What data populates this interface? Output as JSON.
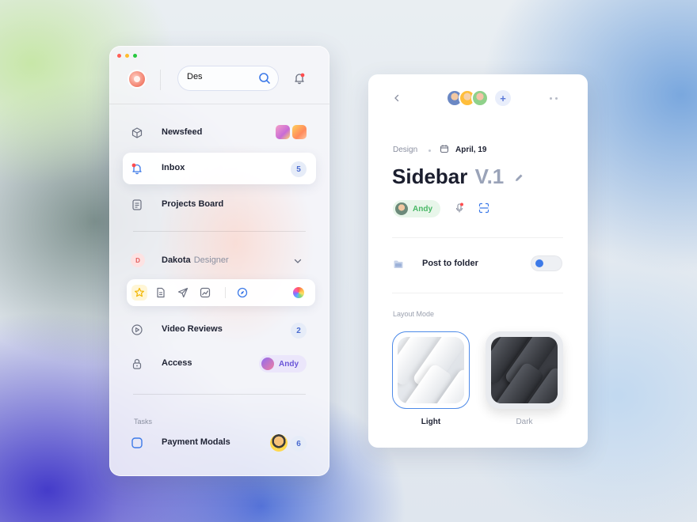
{
  "sidebar": {
    "search": {
      "value": "Des"
    },
    "nav": [
      {
        "label": "Newsfeed"
      },
      {
        "label": "Inbox",
        "badge": "5"
      },
      {
        "label": "Projects Board"
      }
    ],
    "user": {
      "initial": "D",
      "name": "Dakota",
      "role": "Designer"
    },
    "secondary": [
      {
        "label": "Video Reviews",
        "badge": "2"
      },
      {
        "label": "Access",
        "assignee": "Andy"
      }
    ],
    "tasks_label": "Tasks",
    "tasks": [
      {
        "label": "Payment Modals",
        "badge": "6"
      }
    ]
  },
  "detail": {
    "add_label": "+",
    "category": "Design",
    "date": "April, 19",
    "title": "Sidebar",
    "version": "V.1",
    "assignee": "Andy",
    "post_to_folder": {
      "label": "Post to folder",
      "enabled": false
    },
    "layout_mode": {
      "label": "Layout Mode",
      "options": [
        {
          "label": "Light",
          "selected": true
        },
        {
          "label": "Dark",
          "selected": false
        }
      ]
    }
  },
  "colors": {
    "accent_blue": "#3d7ae8",
    "badge_text": "#4a6bd0",
    "andy_purple": "#6a55d8",
    "andy_green": "#49b866",
    "notification_red": "#ff4d4f"
  },
  "icons": [
    "logo-icon",
    "search-icon",
    "bell-icon",
    "cube-icon",
    "document-icon",
    "star-icon",
    "send-icon",
    "chart-icon",
    "compass-icon",
    "play-icon",
    "lock-icon",
    "checkbox-icon",
    "back-icon",
    "calendar-icon",
    "pencil-icon",
    "mic-icon",
    "scan-icon",
    "folder-icon"
  ]
}
